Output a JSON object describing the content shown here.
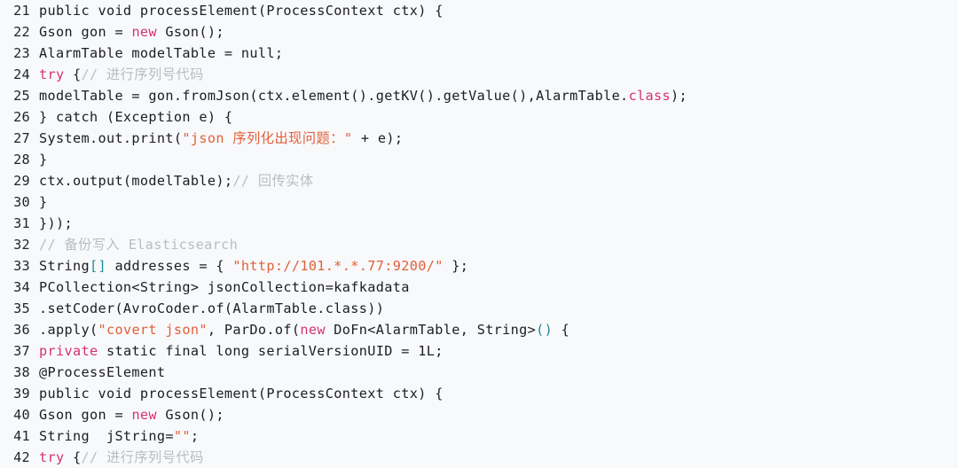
{
  "editor": {
    "language": "java",
    "background_color": "#f8f9fb",
    "line_number_color": "#22242a",
    "first_line_number": 21,
    "last_line_number": 42,
    "colors": {
      "plain": "#1b1d22",
      "keyword": "#d6336c",
      "string": "#e2603a",
      "comment": "#b9bcc4",
      "bracket": "#1f8a94"
    }
  },
  "lines": [
    {
      "number": "21",
      "text": "public void processElement(ProcessContext ctx) {",
      "tokens": [
        {
          "t": "public void processElement(ProcessContext ctx) {",
          "c": "plain"
        }
      ]
    },
    {
      "number": "22",
      "text": "Gson gon = new Gson();",
      "tokens": [
        {
          "t": "Gson gon = ",
          "c": "plain"
        },
        {
          "t": "new",
          "c": "keyword"
        },
        {
          "t": " Gson();",
          "c": "plain"
        }
      ]
    },
    {
      "number": "23",
      "text": "AlarmTable modelTable = null;",
      "tokens": [
        {
          "t": "AlarmTable modelTable = null;",
          "c": "plain"
        }
      ]
    },
    {
      "number": "24",
      "text": "try {// 进行序列号代码",
      "tokens": [
        {
          "t": "try",
          "c": "keyword"
        },
        {
          "t": " {",
          "c": "plain"
        },
        {
          "t": "// ",
          "c": "comment"
        },
        {
          "t": "进行序列号代码",
          "c": "comment cjk"
        }
      ]
    },
    {
      "number": "25",
      "text": "modelTable = gon.fromJson(ctx.element().getKV().getValue(),AlarmTable.class);",
      "tokens": [
        {
          "t": "modelTable = gon.fromJson(ctx.element().getKV().getValue(),AlarmTable.",
          "c": "plain"
        },
        {
          "t": "class",
          "c": "keyword"
        },
        {
          "t": ");",
          "c": "plain"
        }
      ]
    },
    {
      "number": "26",
      "text": "} catch (Exception e) {",
      "tokens": [
        {
          "t": "} catch (Exception e) {",
          "c": "plain"
        }
      ]
    },
    {
      "number": "27",
      "text": "System.out.print(\"json 序列化出现问题：\" + e);",
      "tokens": [
        {
          "t": "System.out.print(",
          "c": "plain"
        },
        {
          "t": "\"json ",
          "c": "string"
        },
        {
          "t": "序列化出现问题：",
          "c": "string cjk"
        },
        {
          "t": "\"",
          "c": "string"
        },
        {
          "t": " + e);",
          "c": "plain"
        }
      ]
    },
    {
      "number": "28",
      "text": "}",
      "tokens": [
        {
          "t": "}",
          "c": "plain"
        }
      ]
    },
    {
      "number": "29",
      "text": "ctx.output(modelTable);// 回传实体",
      "tokens": [
        {
          "t": "ctx.output(modelTable);",
          "c": "plain"
        },
        {
          "t": "// ",
          "c": "comment"
        },
        {
          "t": "回传实体",
          "c": "comment cjk"
        }
      ]
    },
    {
      "number": "30",
      "text": "}",
      "tokens": [
        {
          "t": "}",
          "c": "plain"
        }
      ]
    },
    {
      "number": "31",
      "text": "}));",
      "tokens": [
        {
          "t": "}));",
          "c": "plain"
        }
      ]
    },
    {
      "number": "32",
      "text": "// 备份写入 Elasticsearch",
      "tokens": [
        {
          "t": "// ",
          "c": "comment"
        },
        {
          "t": "备份写入",
          "c": "comment cjk"
        },
        {
          "t": " Elasticsearch",
          "c": "comment"
        }
      ]
    },
    {
      "number": "33",
      "text": "String[] addresses = { \"http://101.*.*.77:9200/\" };",
      "tokens": [
        {
          "t": "String",
          "c": "plain"
        },
        {
          "t": "[]",
          "c": "bracket"
        },
        {
          "t": " addresses = { ",
          "c": "plain"
        },
        {
          "t": "\"http://101.*.*.77:9200/\"",
          "c": "string"
        },
        {
          "t": " };",
          "c": "plain"
        }
      ]
    },
    {
      "number": "34",
      "text": "PCollection<String> jsonCollection=kafkadata",
      "tokens": [
        {
          "t": "PCollection<String> jsonCollection=kafkadata",
          "c": "plain"
        }
      ]
    },
    {
      "number": "35",
      "text": ".setCoder(AvroCoder.of(AlarmTable.class))",
      "tokens": [
        {
          "t": ".setCoder(AvroCoder.of(AlarmTable.class))",
          "c": "plain"
        }
      ]
    },
    {
      "number": "36",
      "text": ".apply(\"covert json\", ParDo.of(new DoFn<AlarmTable, String>() {",
      "tokens": [
        {
          "t": ".apply(",
          "c": "plain"
        },
        {
          "t": "\"covert json\"",
          "c": "string"
        },
        {
          "t": ", ParDo.of(",
          "c": "plain"
        },
        {
          "t": "new",
          "c": "keyword"
        },
        {
          "t": " DoFn<AlarmTable, String>",
          "c": "plain"
        },
        {
          "t": "()",
          "c": "bracket"
        },
        {
          "t": " {",
          "c": "plain"
        }
      ]
    },
    {
      "number": "37",
      "text": "private static final long serialVersionUID = 1L;",
      "tokens": [
        {
          "t": "private",
          "c": "keyword"
        },
        {
          "t": " static final long serialVersionUID = 1L;",
          "c": "plain"
        }
      ]
    },
    {
      "number": "38",
      "text": "@ProcessElement",
      "tokens": [
        {
          "t": "@ProcessElement",
          "c": "plain"
        }
      ]
    },
    {
      "number": "39",
      "text": "public void processElement(ProcessContext ctx) {",
      "tokens": [
        {
          "t": "public void processElement(ProcessContext ctx) {",
          "c": "plain"
        }
      ]
    },
    {
      "number": "40",
      "text": "Gson gon = new Gson();",
      "tokens": [
        {
          "t": "Gson gon = ",
          "c": "plain"
        },
        {
          "t": "new",
          "c": "keyword"
        },
        {
          "t": " Gson();",
          "c": "plain"
        }
      ]
    },
    {
      "number": "41",
      "text": "String  jString=\"\";",
      "tokens": [
        {
          "t": "String  jString=",
          "c": "plain"
        },
        {
          "t": "\"\"",
          "c": "string"
        },
        {
          "t": ";",
          "c": "plain"
        }
      ]
    },
    {
      "number": "42",
      "text": "try {// 进行序列号代码",
      "tokens": [
        {
          "t": "try",
          "c": "keyword"
        },
        {
          "t": " {",
          "c": "plain"
        },
        {
          "t": "// ",
          "c": "comment"
        },
        {
          "t": "进行序列号代码",
          "c": "comment cjk"
        }
      ]
    }
  ]
}
